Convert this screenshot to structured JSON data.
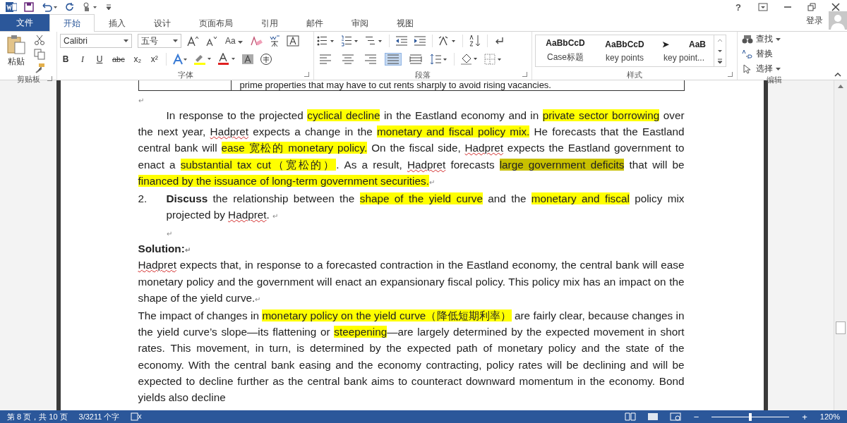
{
  "title_bar": {
    "help": "?",
    "account": "登录"
  },
  "tabs": [
    {
      "label": "文件",
      "kind": "file",
      "selected": false
    },
    {
      "label": "开始",
      "kind": "tab",
      "selected": true
    },
    {
      "label": "插入",
      "kind": "tab",
      "selected": false
    },
    {
      "label": "设计",
      "kind": "tab",
      "selected": false
    },
    {
      "label": "页面布局",
      "kind": "tab",
      "selected": false
    },
    {
      "label": "引用",
      "kind": "tab",
      "selected": false
    },
    {
      "label": "邮件",
      "kind": "tab",
      "selected": false
    },
    {
      "label": "审阅",
      "kind": "tab",
      "selected": false
    },
    {
      "label": "视图",
      "kind": "tab",
      "selected": false
    }
  ],
  "ribbon": {
    "clipboard": {
      "paste": "粘贴",
      "group": "剪贴板"
    },
    "font": {
      "name": "Calibri",
      "size": "五号",
      "case": "Aa",
      "format_buttons": [
        "B",
        "I",
        "U",
        "abc",
        "x₂",
        "x²"
      ],
      "group": "字体"
    },
    "paragraph": {
      "alignments": [
        {
          "selected": false
        },
        {
          "selected": false
        },
        {
          "selected": false
        },
        {
          "selected": true
        },
        {
          "selected": false
        }
      ],
      "group": "段落"
    },
    "styles": {
      "items": [
        {
          "preview": "AaBbCcD",
          "label": "Case标题"
        },
        {
          "preview": "AaBbCcD",
          "label": "key points"
        },
        {
          "bullet": "➤",
          "preview": "AaB",
          "label": "key point..."
        }
      ],
      "group": "样式"
    },
    "editing": {
      "find": "查找",
      "replace": "替换",
      "select": "选择",
      "group": "编辑"
    }
  },
  "document": {
    "table_cell": "prime properties that may have to cut rents sharply to avoid rising vacancies.",
    "blocks": [
      {
        "kind": "empty",
        "indent": false,
        "mark": "↵"
      },
      {
        "kind": "para",
        "indent": true,
        "mark": "↵",
        "segments": [
          {
            "t": "In response to the projected "
          },
          {
            "t": "cyclical decline",
            "color": "#ffff00"
          },
          {
            "t": " in the Eastland economy and in "
          },
          {
            "t": "private sector borrowing",
            "color": "#ffff00"
          },
          {
            "t": " over the next year, "
          },
          {
            "t": "Hadpret",
            "spell": true
          },
          {
            "t": " expects a change in the "
          },
          {
            "t": "monetary and fiscal policy mix.",
            "color": "#ffff00"
          },
          {
            "t": " He forecasts that the Eastland central bank will "
          },
          {
            "t": "ease  宽松的  monetary policy.",
            "color": "#ffff00"
          },
          {
            "t": " On the fiscal side, "
          },
          {
            "t": "Hadpret",
            "spell": true
          },
          {
            "t": " expects the Eastland government to enact a "
          },
          {
            "t": "substantial tax cut（宽松的）",
            "color": "#ffff00"
          },
          {
            "t": ". As a result, "
          },
          {
            "t": "Hadpret",
            "spell": true
          },
          {
            "t": " forecasts "
          },
          {
            "t": "large government deficits",
            "color": "#c8c000"
          },
          {
            "t": " that will be "
          },
          {
            "t": "financed by the issuance of long-term government securities.",
            "color": "#ffff00"
          }
        ]
      },
      {
        "kind": "numbered",
        "number": "2.",
        "mark": "↵",
        "segments": [
          {
            "t": "Discuss",
            "bold": true
          },
          {
            "t": " the relationship between the "
          },
          {
            "t": "shape of the yield curve",
            "color": "#ffff00"
          },
          {
            "t": " and the "
          },
          {
            "t": "monetary and fiscal",
            "color": "#ffff00"
          },
          {
            "t": " policy mix projected by "
          },
          {
            "t": "Hadpret",
            "spell": true
          },
          {
            "t": ".  "
          }
        ]
      },
      {
        "kind": "empty",
        "indent": true,
        "mark": "↵"
      },
      {
        "kind": "heading",
        "text": "Solution:",
        "mark": "↵"
      },
      {
        "kind": "para",
        "indent": false,
        "mark": "↵",
        "segments": [
          {
            "t": "Hadpret",
            "spell": true
          },
          {
            "t": " expects that, in response to a forecasted contraction in the Eastland economy, the central bank will ease monetary policy and the government will enact an expansionary fiscal policy. This policy mix has an impact on the shape of the yield curve."
          }
        ]
      },
      {
        "kind": "para",
        "indent": false,
        "segments": [
          {
            "t": "The impact of changes in "
          },
          {
            "t": "monetary policy on the yield curve（降低短期利率）",
            "color": "#ffff00"
          },
          {
            "t": "  are fairly clear, because changes in the yield curve’s slope—its flattening or "
          },
          {
            "t": "steepening",
            "color": "#ffff00"
          },
          {
            "t": "—are largely determined by the expected movement in short rates. This movement, in turn, is determined by the expected path of monetary policy and the state of the economy. With the central bank easing and the economy contracting, policy rates will be declining and will be expected to decline further as the central bank aims to counteract downward momentum in the economy. Bond yields also decline"
          }
        ]
      }
    ]
  },
  "status_bar": {
    "page": "第 8 页，共 10 页",
    "words": "3/3211 个字",
    "zoom_minus": "−",
    "zoom_plus": "+",
    "zoom": {
      "level": 0.5
    },
    "zoom_reading": "120%"
  }
}
